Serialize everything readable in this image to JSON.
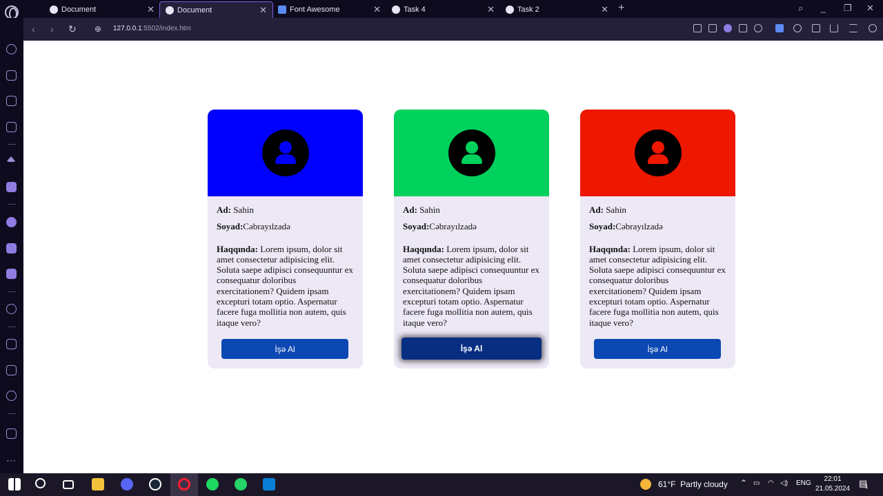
{
  "browser": {
    "tabs": [
      {
        "label": "Document",
        "active": false
      },
      {
        "label": "Document",
        "active": true
      },
      {
        "label": "Font Awesome",
        "active": false
      },
      {
        "label": "Task 4",
        "active": false
      },
      {
        "label": "Task 2",
        "active": false
      }
    ],
    "url_host": "127.0.0.1",
    "url_rest": ":5502/index.htm"
  },
  "cards": [
    {
      "color": "#0000ff",
      "ad_label": "Ad:",
      "ad_value": " Sahin",
      "soyad_label": "Soyad:",
      "soyad_value": "Cəbrayılzadə",
      "about_label": "Haqqında:",
      "about_text": " Lorem ipsum, dolor sit amet consectetur adipisicing elit. Soluta saepe adipisci consequuntur ex consequatur doloribus exercitationem? Quidem ipsam excepturi totam optio. Aspernatur facere fuga mollitia non autem, quis itaque vero?",
      "button": "İşə Al"
    },
    {
      "color": "#00d15c",
      "ad_label": "Ad:",
      "ad_value": " Sahin",
      "soyad_label": "Soyad:",
      "soyad_value": "Cəbrayılzadə",
      "about_label": "Haqqında:",
      "about_text": " Lorem ipsum, dolor sit amet consectetur adipisicing elit. Soluta saepe adipisci consequuntur ex consequatur doloribus exercitationem? Quidem ipsam excepturi totam optio. Aspernatur facere fuga mollitia non autem, quis itaque vero?",
      "button": "İşə Al"
    },
    {
      "color": "#ee1700",
      "ad_label": "Ad:",
      "ad_value": " Sahin",
      "soyad_label": "Soyad:",
      "soyad_value": "Cəbrayılzadə",
      "about_label": "Haqqında:",
      "about_text": " Lorem ipsum, dolor sit amet consectetur adipisicing elit. Soluta saepe adipisci consequuntur ex consequatur doloribus exercitationem? Quidem ipsam excepturi totam optio. Aspernatur facere fuga mollitia non autem, quis itaque vero?",
      "button": "İşə Al"
    }
  ],
  "taskbar": {
    "weather_temp": "61°F",
    "weather_desc": "Partly cloudy",
    "lang": "ENG",
    "time": "22:01",
    "date": "21.05.2024",
    "notif_count": "1"
  }
}
